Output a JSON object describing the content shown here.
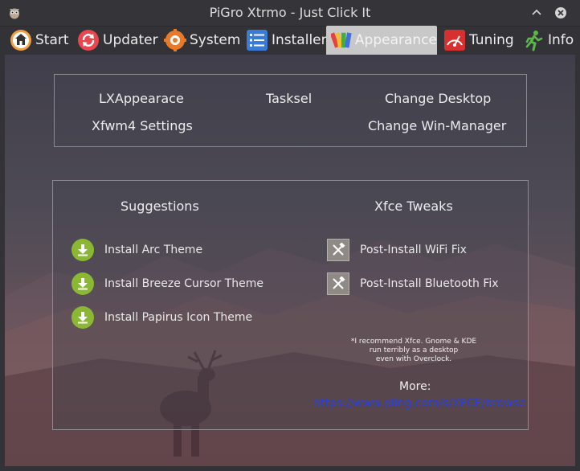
{
  "window": {
    "title": "PiGro Xtrmo - Just Click It",
    "app_icon": "owl-icon",
    "min_icon": "chevron-up-icon",
    "close_icon": "close-icon"
  },
  "tabs": [
    {
      "label": "Start",
      "icon": "home-icon"
    },
    {
      "label": "Updater",
      "icon": "refresh-icon"
    },
    {
      "label": "System",
      "icon": "gear-icon"
    },
    {
      "label": "Installer",
      "icon": "list-icon"
    },
    {
      "label": "Appearance",
      "icon": "palette-icon",
      "active": true
    },
    {
      "label": "Tuning",
      "icon": "speedometer-icon"
    },
    {
      "label": "Info",
      "icon": "runner-icon"
    }
  ],
  "top_panel": {
    "lxappearance": "LXAppearace",
    "tasksel": "Tasksel",
    "change_desktop": "Change Desktop",
    "xfwm4_settings": "Xfwm4 Settings",
    "change_wm": "Change Win-Manager"
  },
  "suggestions": {
    "heading": "Suggestions",
    "items": [
      {
        "label": "Install Arc Theme",
        "icon": "download-icon"
      },
      {
        "label": "Install Breeze Cursor Theme",
        "icon": "download-icon"
      },
      {
        "label": "Install Papirus Icon Theme",
        "icon": "download-icon"
      }
    ]
  },
  "xfce_tweaks": {
    "heading": "Xfce Tweaks",
    "items": [
      {
        "label": "Post-Install WiFi Fix",
        "icon": "tools-icon"
      },
      {
        "label": "Post-Install Bluetooth Fix",
        "icon": "tools-icon"
      }
    ],
    "note_lines": [
      "*I recommend Xfce. Gnome & KDE",
      "run terribly as a desktop",
      "even with Overclock."
    ],
    "more_label": "More:",
    "more_url": "https://www.pling.com/s/XFCE/browse"
  },
  "colors": {
    "download_green": "#8ab832",
    "link_blue": "#2a3fd8",
    "active_tab": "#c8c8c8"
  }
}
